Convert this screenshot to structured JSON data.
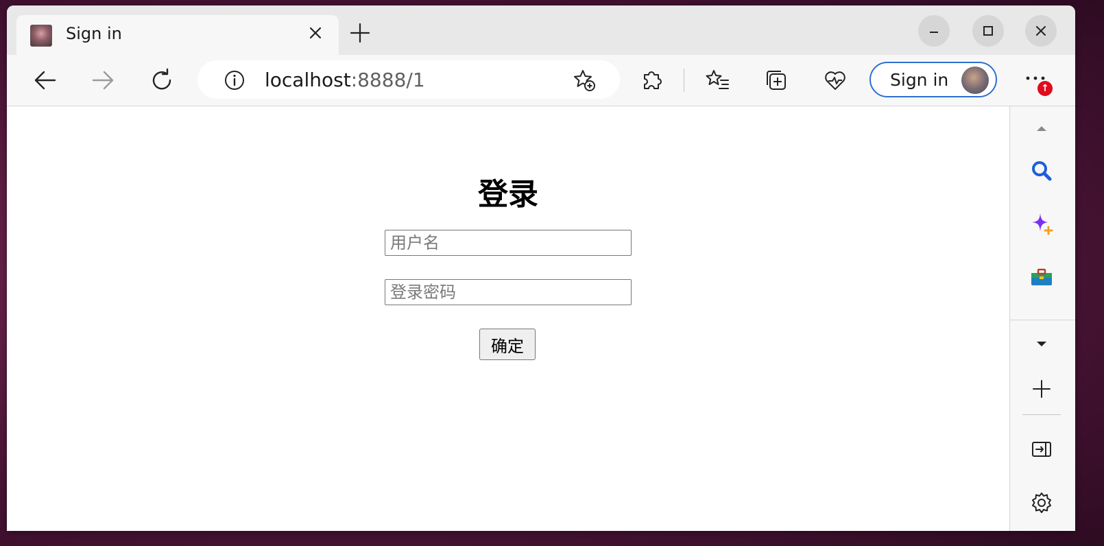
{
  "browser": {
    "tab": {
      "title": "Sign in",
      "close_icon": "close-icon",
      "favicon": "site-favicon"
    },
    "new_tab_icon": "plus-icon",
    "window_controls": [
      "minimize-icon",
      "maximize-icon",
      "close-icon"
    ],
    "toolbar": {
      "back_icon": "arrow-left-icon",
      "forward_icon": "arrow-right-icon",
      "refresh_icon": "refresh-icon",
      "site_info_icon": "info-icon",
      "url_host": "localhost",
      "url_rest": ":8888/1",
      "add_favorite_icon": "star-add-icon",
      "extensions_icon": "puzzle-icon",
      "favorites_icon": "favorites-list-icon",
      "collections_icon": "collections-icon",
      "browser_essentials_icon": "heart-pulse-icon",
      "signin_label": "Sign in",
      "more_icon": "ellipsis-icon",
      "badge_symbol": "↑"
    },
    "sidebar": {
      "icons": [
        "scroll-up-icon",
        "search-icon",
        "copilot-sparkle-icon",
        "tools-briefcase-icon",
        "scroll-down-icon",
        "add-icon",
        "hide-sidebar-icon",
        "settings-icon"
      ]
    }
  },
  "page": {
    "title": "登录",
    "username_placeholder": "用户名",
    "password_placeholder": "登录密码",
    "submit_label": "确定"
  },
  "colors": {
    "accent": "#2d6fd0",
    "badge": "#e00b1c",
    "search_icon": "#1d5fd6",
    "copilot": "#7b2ff2"
  }
}
